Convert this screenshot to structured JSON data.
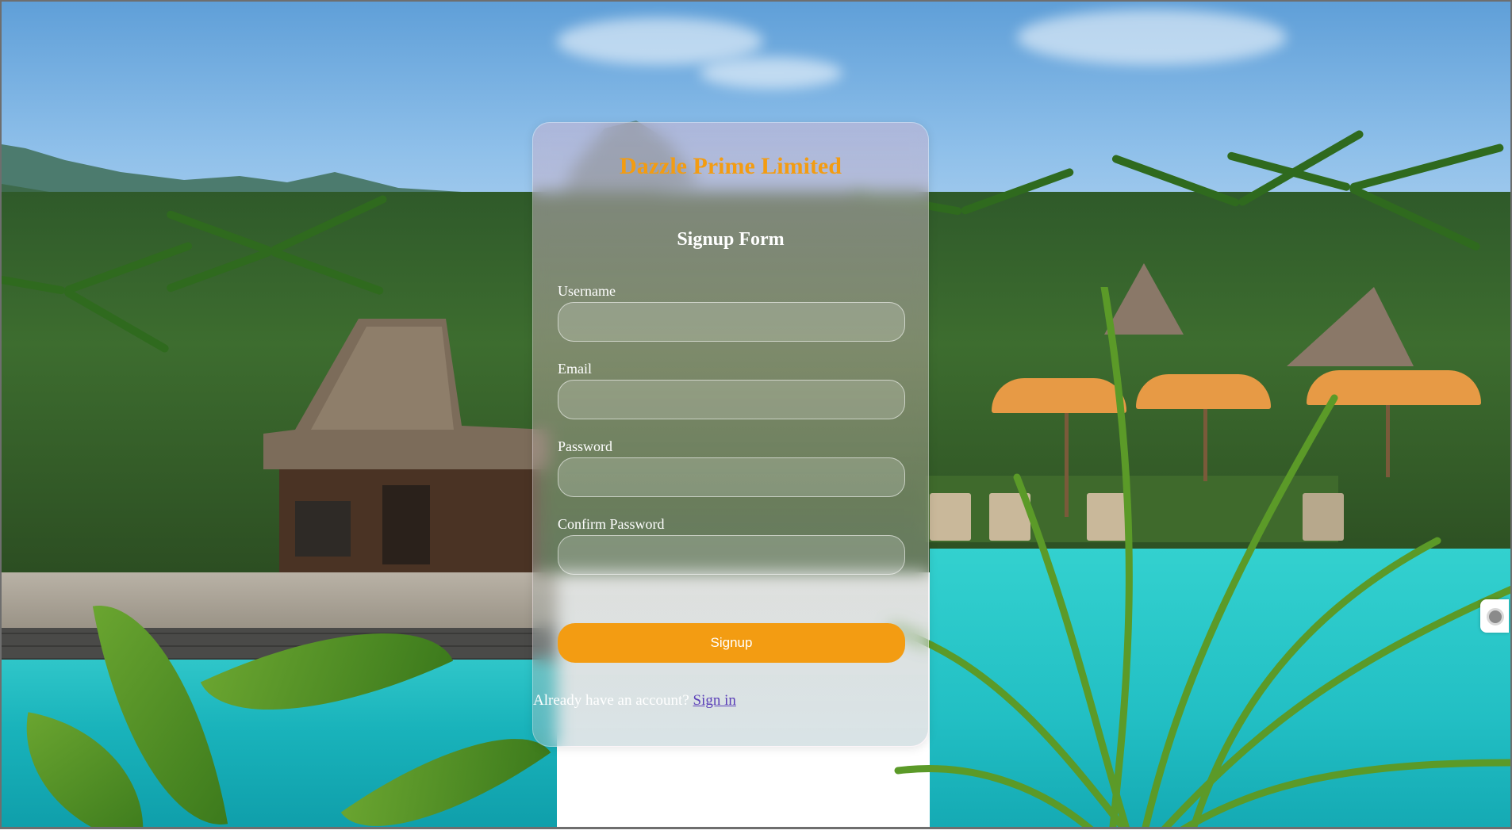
{
  "brand": {
    "name": "Dazzle Prime Limited",
    "color": "#f39c12"
  },
  "form": {
    "title": "Signup Form",
    "fields": [
      {
        "label": "Username",
        "value": "",
        "placeholder": ""
      },
      {
        "label": "Email",
        "value": "",
        "placeholder": ""
      },
      {
        "label": "Password",
        "value": "",
        "placeholder": ""
      },
      {
        "label": "Confirm Password",
        "value": "",
        "placeholder": ""
      }
    ],
    "submit_label": "Signup",
    "signin_prompt": "Already have an account?",
    "signin_link": "Sign in"
  },
  "colors": {
    "accent": "#f39c12",
    "link": "#5b3fb8"
  },
  "background": {
    "icon": "resort-pool-background"
  },
  "side_widget": {
    "icon": "floating-handle-icon"
  }
}
